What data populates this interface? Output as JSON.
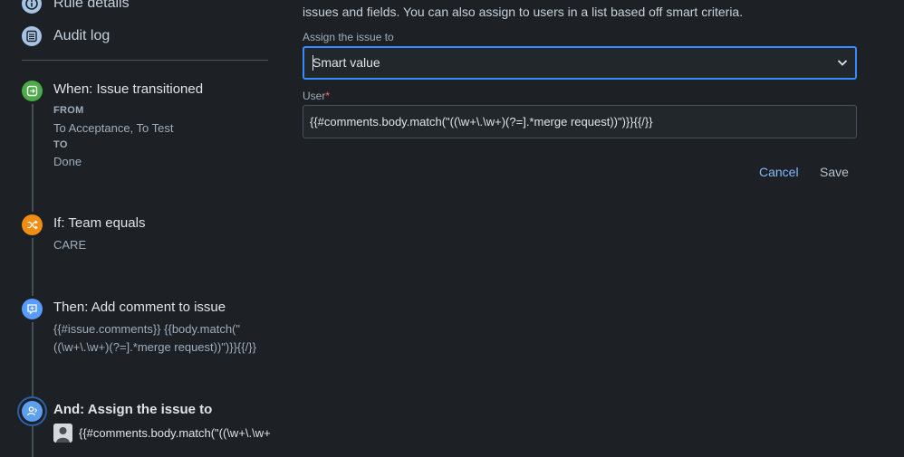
{
  "sidebar": {
    "menu": [
      {
        "label": "Rule details",
        "icon": "info-icon"
      },
      {
        "label": "Audit log",
        "icon": "list-icon"
      }
    ]
  },
  "rule": {
    "trigger": {
      "title": "When: Issue transitioned",
      "from_key": "FROM",
      "from_value": "To Acceptance, To Test",
      "to_key": "TO",
      "to_value": "Done",
      "icon": "transition-icon",
      "color": "#4bab48"
    },
    "condition": {
      "title": "If: Team equals",
      "value": "CARE",
      "icon": "shuffle-icon",
      "color": "#f18d13"
    },
    "action_comment": {
      "title": "Then: Add comment to issue",
      "line1": "{{#issue.comments}} {{body.match(\"",
      "line2": "((\\w+\\.\\w+)(?=].*merge request))\")}}{{/}}",
      "icon": "comment-icon",
      "color": "#579dff"
    },
    "action_assign": {
      "title": "And: Assign the issue to",
      "value": "{{#comments.body.match(\"((\\w+\\.\\w+",
      "icon": "assign-user-icon",
      "color": "#5ea0f0"
    }
  },
  "form": {
    "description": "issues and fields. You can also assign to users in a list based off smart criteria.",
    "assign_label": "Assign the issue to",
    "assign_value": "Smart value",
    "user_label": "User",
    "required_mark": "*",
    "user_value": "{{#comments.body.match(\"((\\w+\\.\\w+)(?=].*merge request))\")}}{{/}}",
    "cancel_label": "Cancel",
    "save_label": "Save"
  }
}
